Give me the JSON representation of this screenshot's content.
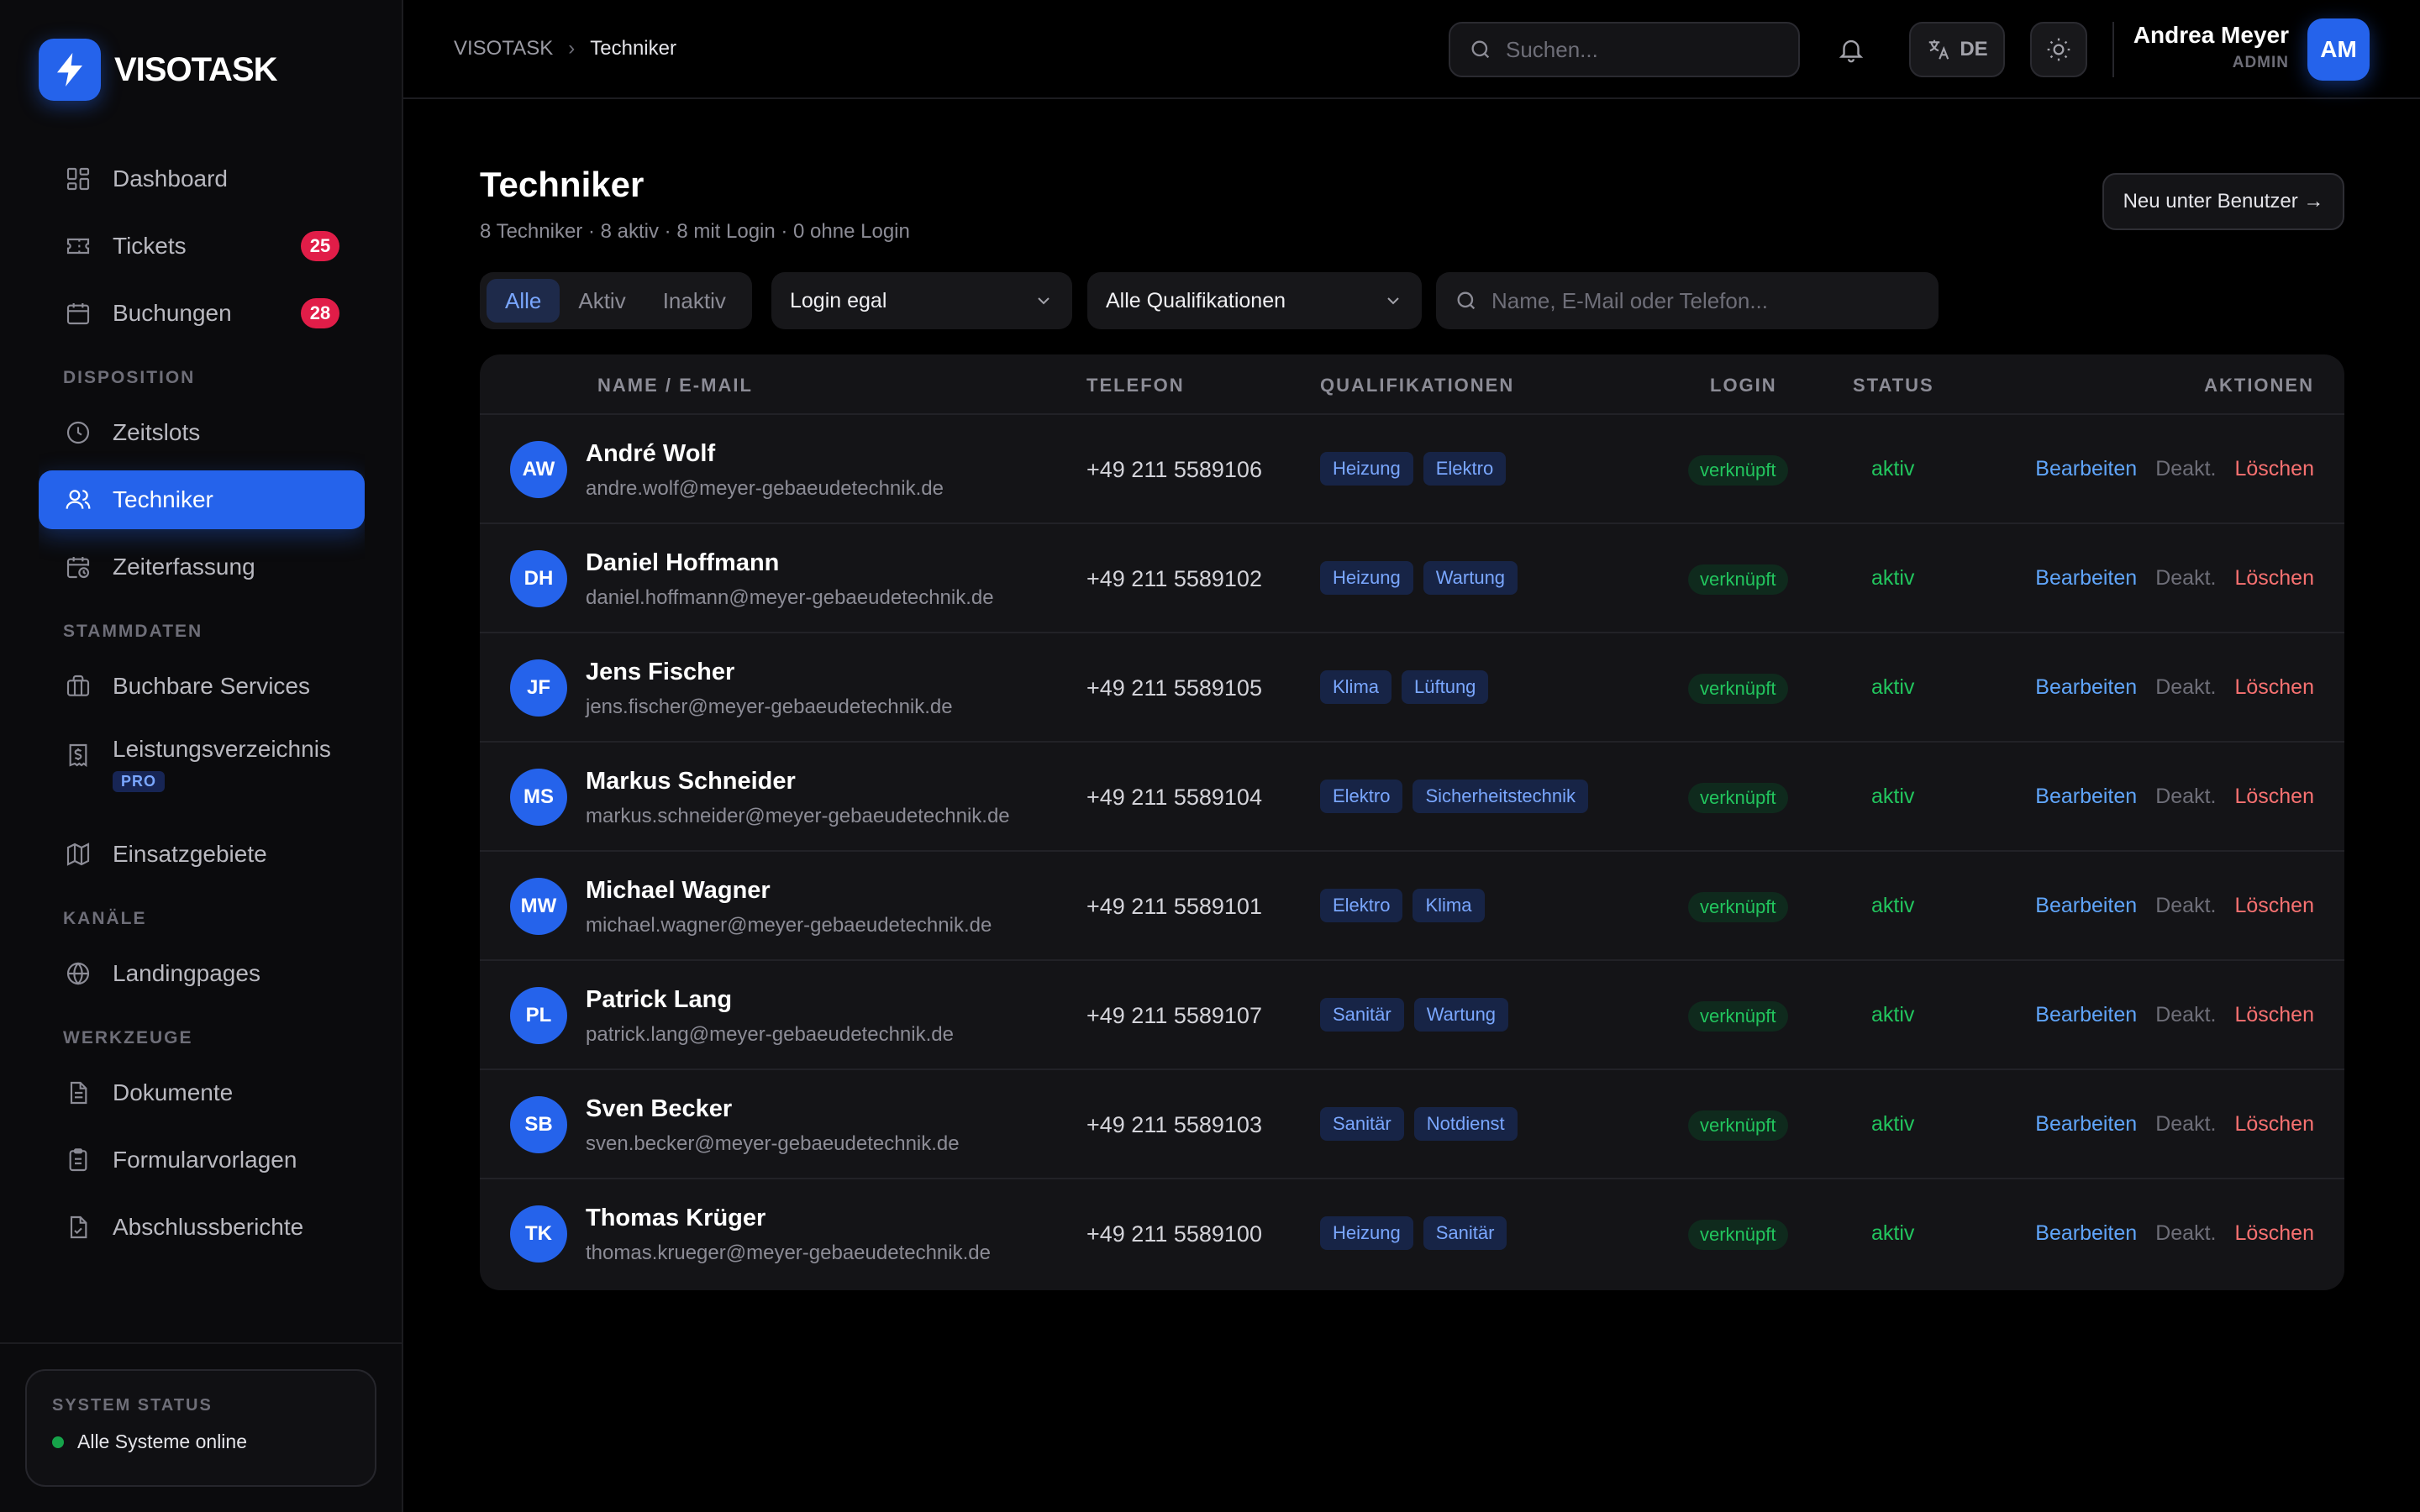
{
  "app": {
    "name": "VISOTASK"
  },
  "sidebar": {
    "items_top": [
      {
        "label": "Dashboard",
        "icon": "dashboard-icon"
      },
      {
        "label": "Tickets",
        "icon": "ticket-icon",
        "count": "25"
      },
      {
        "label": "Buchungen",
        "icon": "calendar-icon",
        "count": "28"
      }
    ],
    "sections": {
      "disposition": "DISPOSITION",
      "stammdaten": "STAMMDATEN",
      "kanaele": "KANÄLE",
      "werkzeuge": "WERKZEUGE"
    },
    "disposition_items": [
      {
        "label": "Zeitslots",
        "icon": "clock-icon"
      },
      {
        "label": "Techniker",
        "icon": "users-icon",
        "active": true
      },
      {
        "label": "Zeiterfassung",
        "icon": "calendar-clock-icon"
      }
    ],
    "stammdaten_items": [
      {
        "label": "Buchbare Services",
        "icon": "briefcase-icon"
      },
      {
        "label": "Leistungsverzeichnis",
        "icon": "receipt-icon",
        "badge": "PRO"
      },
      {
        "label": "Einsatzgebiete",
        "icon": "map-icon"
      }
    ],
    "kanaele_items": [
      {
        "label": "Landingpages",
        "icon": "globe-icon"
      }
    ],
    "werkzeuge_items": [
      {
        "label": "Dokumente",
        "icon": "document-icon"
      },
      {
        "label": "Formularvorlagen",
        "icon": "clipboard-icon"
      },
      {
        "label": "Abschlussberichte",
        "icon": "report-icon"
      }
    ],
    "system_status": {
      "title": "SYSTEM STATUS",
      "text": "Alle Systeme online",
      "color": "#16a34a"
    }
  },
  "topbar": {
    "breadcrumb": [
      "VISOTASK",
      "Techniker"
    ],
    "search_placeholder": "Suchen...",
    "language": "DE",
    "user": {
      "name": "Andrea Meyer",
      "role": "ADMIN",
      "initials": "AM"
    }
  },
  "main": {
    "title": "Techniker",
    "subtitle": "8 Techniker · 8 aktiv · 8 mit Login · 0 ohne Login",
    "new_button": "Neu unter Benutzer →",
    "filters": {
      "segments": [
        "Alle",
        "Aktiv",
        "Inaktiv"
      ],
      "login": "Login egal",
      "qualification": "Alle Qualifikationen",
      "search_placeholder": "Name, E-Mail oder Telefon..."
    },
    "table": {
      "headers": {
        "name": "NAME / E-MAIL",
        "phone": "TELEFON",
        "quals": "QUALIFIKATIONEN",
        "login": "LOGIN",
        "status": "STATUS",
        "actions": "AKTIONEN"
      },
      "actions": {
        "edit": "Bearbeiten",
        "deactivate": "Deakt.",
        "delete": "Löschen"
      },
      "rows": [
        {
          "initials": "AW",
          "name": "André Wolf",
          "email": "andre.wolf@meyer-gebaeudetechnik.de",
          "phone": "+49 211 5589106",
          "quals": [
            "Heizung",
            "Elektro"
          ],
          "login": "verknüpft",
          "status": "aktiv"
        },
        {
          "initials": "DH",
          "name": "Daniel Hoffmann",
          "email": "daniel.hoffmann@meyer-gebaeudetechnik.de",
          "phone": "+49 211 5589102",
          "quals": [
            "Heizung",
            "Wartung"
          ],
          "login": "verknüpft",
          "status": "aktiv"
        },
        {
          "initials": "JF",
          "name": "Jens Fischer",
          "email": "jens.fischer@meyer-gebaeudetechnik.de",
          "phone": "+49 211 5589105",
          "quals": [
            "Klima",
            "Lüftung"
          ],
          "login": "verknüpft",
          "status": "aktiv"
        },
        {
          "initials": "MS",
          "name": "Markus Schneider",
          "email": "markus.schneider@meyer-gebaeudetechnik.de",
          "phone": "+49 211 5589104",
          "quals": [
            "Elektro",
            "Sicherheitstechnik"
          ],
          "login": "verknüpft",
          "status": "aktiv"
        },
        {
          "initials": "MW",
          "name": "Michael Wagner",
          "email": "michael.wagner@meyer-gebaeudetechnik.de",
          "phone": "+49 211 5589101",
          "quals": [
            "Elektro",
            "Klima"
          ],
          "login": "verknüpft",
          "status": "aktiv"
        },
        {
          "initials": "PL",
          "name": "Patrick Lang",
          "email": "patrick.lang@meyer-gebaeudetechnik.de",
          "phone": "+49 211 5589107",
          "quals": [
            "Sanitär",
            "Wartung"
          ],
          "login": "verknüpft",
          "status": "aktiv"
        },
        {
          "initials": "SB",
          "name": "Sven Becker",
          "email": "sven.becker@meyer-gebaeudetechnik.de",
          "phone": "+49 211 5589103",
          "quals": [
            "Sanitär",
            "Notdienst"
          ],
          "login": "verknüpft",
          "status": "aktiv"
        },
        {
          "initials": "TK",
          "name": "Thomas Krüger",
          "email": "thomas.krueger@meyer-gebaeudetechnik.de",
          "phone": "+49 211 5589100",
          "quals": [
            "Heizung",
            "Sanitär"
          ],
          "login": "verknüpft",
          "status": "aktiv"
        }
      ]
    }
  },
  "colors": {
    "accent": "#2563eb",
    "success": "#22c55e",
    "danger": "#f87171",
    "badge": "#e11d48"
  }
}
